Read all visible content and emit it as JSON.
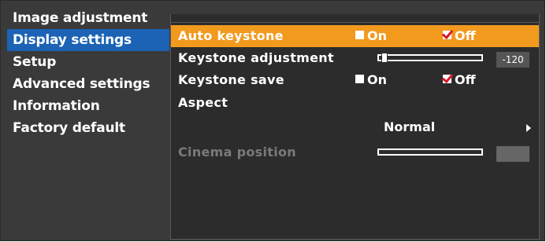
{
  "left_menu": {
    "items": [
      {
        "label": "Image adjustment"
      },
      {
        "label": "Display settings"
      },
      {
        "label": "Setup"
      },
      {
        "label": "Advanced settings"
      },
      {
        "label": "Information"
      },
      {
        "label": "Factory default"
      }
    ],
    "selected_index": 1,
    "selected_color": "#1c62b5"
  },
  "display_settings": {
    "auto_keystone": {
      "label": "Auto keystone",
      "on_label": "On",
      "off_label": "Off",
      "selected": "Off"
    },
    "keystone_adjustment": {
      "label": "Keystone adjustment",
      "value": "-120"
    },
    "keystone_save": {
      "label": "Keystone save",
      "on_label": "On",
      "off_label": "Off",
      "selected": "Off"
    },
    "aspect": {
      "label": "Aspect",
      "value": "Normal"
    },
    "cinema_position": {
      "label": "Cinema position",
      "enabled": false
    }
  },
  "colors": {
    "highlight": "#f29a1e",
    "background": "#3a3a3a",
    "panel": "#2c2c2c",
    "check": "#d6182a"
  },
  "icons": [
    "arrow-right-icon",
    "checkbox-icon",
    "checkbox-checked-icon"
  ]
}
